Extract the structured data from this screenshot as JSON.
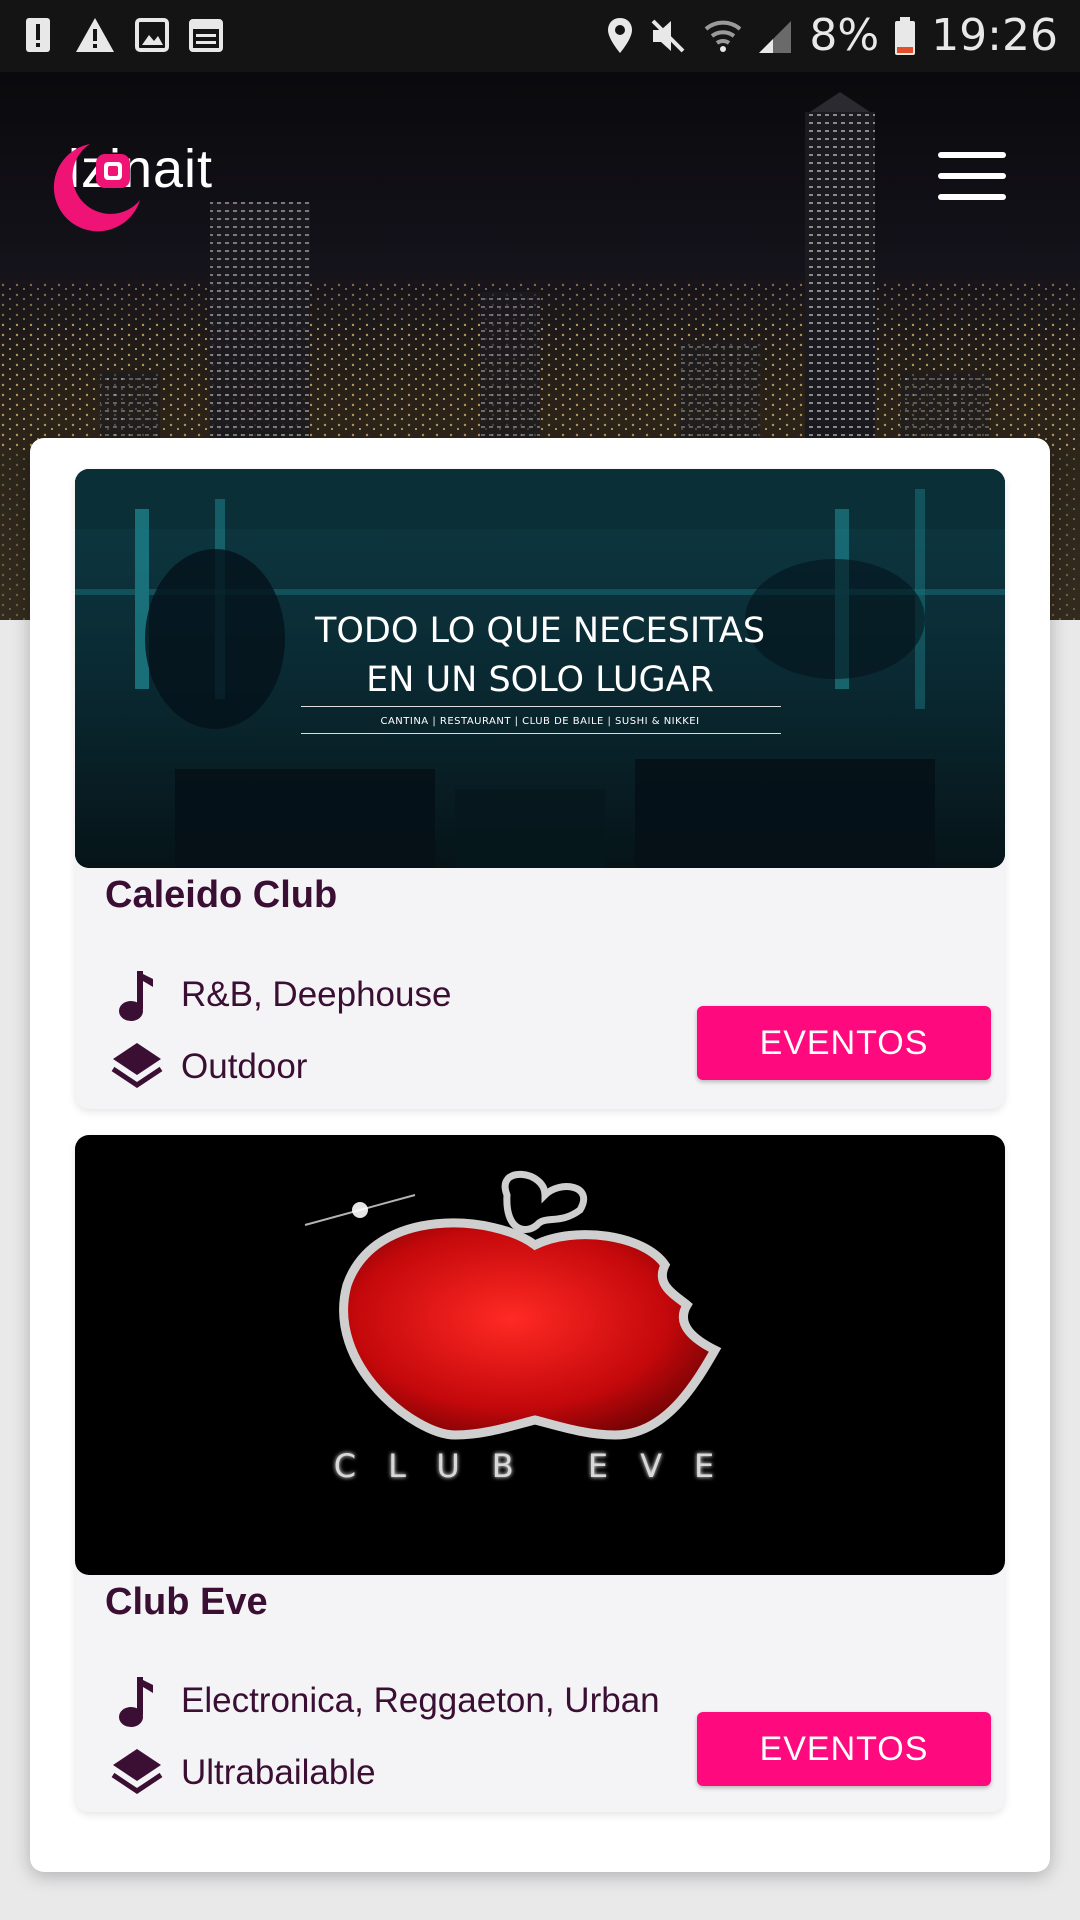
{
  "status_bar": {
    "battery": "8%",
    "time": "19:26",
    "left_icons": [
      "alert-box-icon",
      "warning-icon",
      "image-icon",
      "calendar-icon"
    ],
    "right_icons": [
      "location-icon",
      "mute-icon",
      "wifi-icon",
      "signal-icon",
      "battery-icon"
    ]
  },
  "header": {
    "brand": "izinait",
    "logo_icon": "crescent-logo-icon",
    "menu_icon": "hamburger-menu-icon"
  },
  "colors": {
    "accent": "#ff0a7e",
    "title_text": "#3a0f33",
    "logo": "#ee1375"
  },
  "clubs": [
    {
      "name": "Caleido Club",
      "image_headline_line1": "TODO LO QUE NECESITAS",
      "image_headline_line2": "EN UN SOLO LUGAR",
      "image_subline": "CANTINA | RESTAURANT | CLUB DE BAILE | SUSHI & NIKKEI",
      "music": "R&B, Deephouse",
      "type": "Outdoor",
      "button": "EVENTOS"
    },
    {
      "name": "Club Eve",
      "image_logo_text": "CLUB EVE",
      "music": "Electronica, Reggaeton, Urban",
      "type": "Ultrabailable",
      "button": "EVENTOS"
    }
  ]
}
